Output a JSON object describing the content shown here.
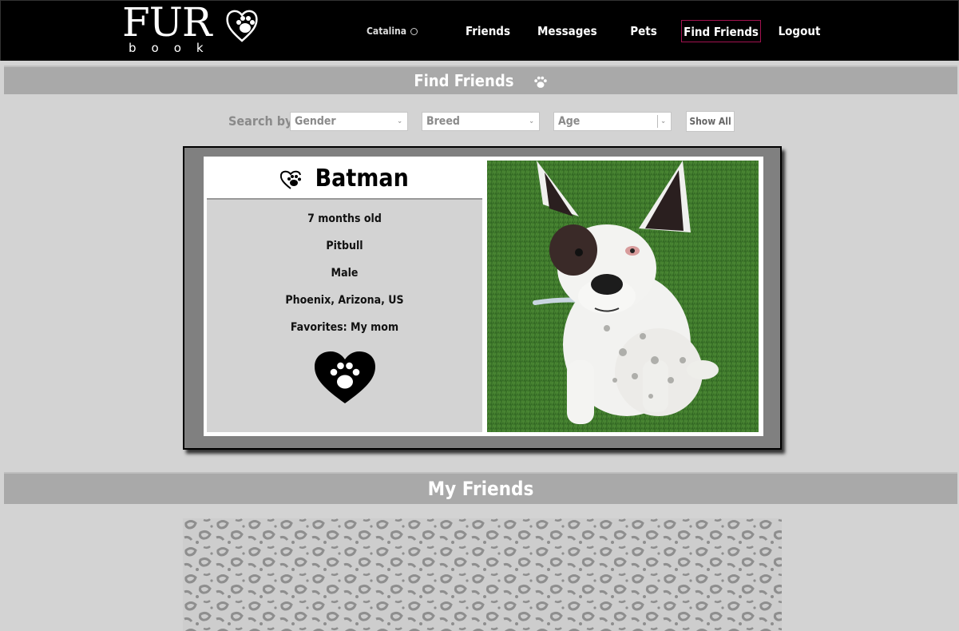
{
  "nav": {
    "logo_main": "FUR",
    "logo_sub": "book",
    "user_name": "Catalina",
    "links": [
      "Friends",
      "Messages",
      "Pets",
      "Find Friends",
      "Logout"
    ],
    "active_link": "Find Friends"
  },
  "find_friends": {
    "title": "Find Friends",
    "search_label": "Search by",
    "filters": {
      "gender": "Gender",
      "breed": "Breed",
      "age": "Age"
    },
    "show_all_label": "Show All"
  },
  "pet_card": {
    "name": "Batman",
    "age": "7 months old",
    "breed": "Pitbull",
    "gender": "Male",
    "location": "Phoenix, Arizona, US",
    "favorites": "Favorites: My mom"
  },
  "my_friends": {
    "title": "My Friends"
  },
  "colors": {
    "nav_bg": "#000000",
    "page_bg": "#d3d3d3",
    "banner_bg": "#a9a9a9",
    "active_border": "#a2124f",
    "card_frame": "#808080"
  }
}
